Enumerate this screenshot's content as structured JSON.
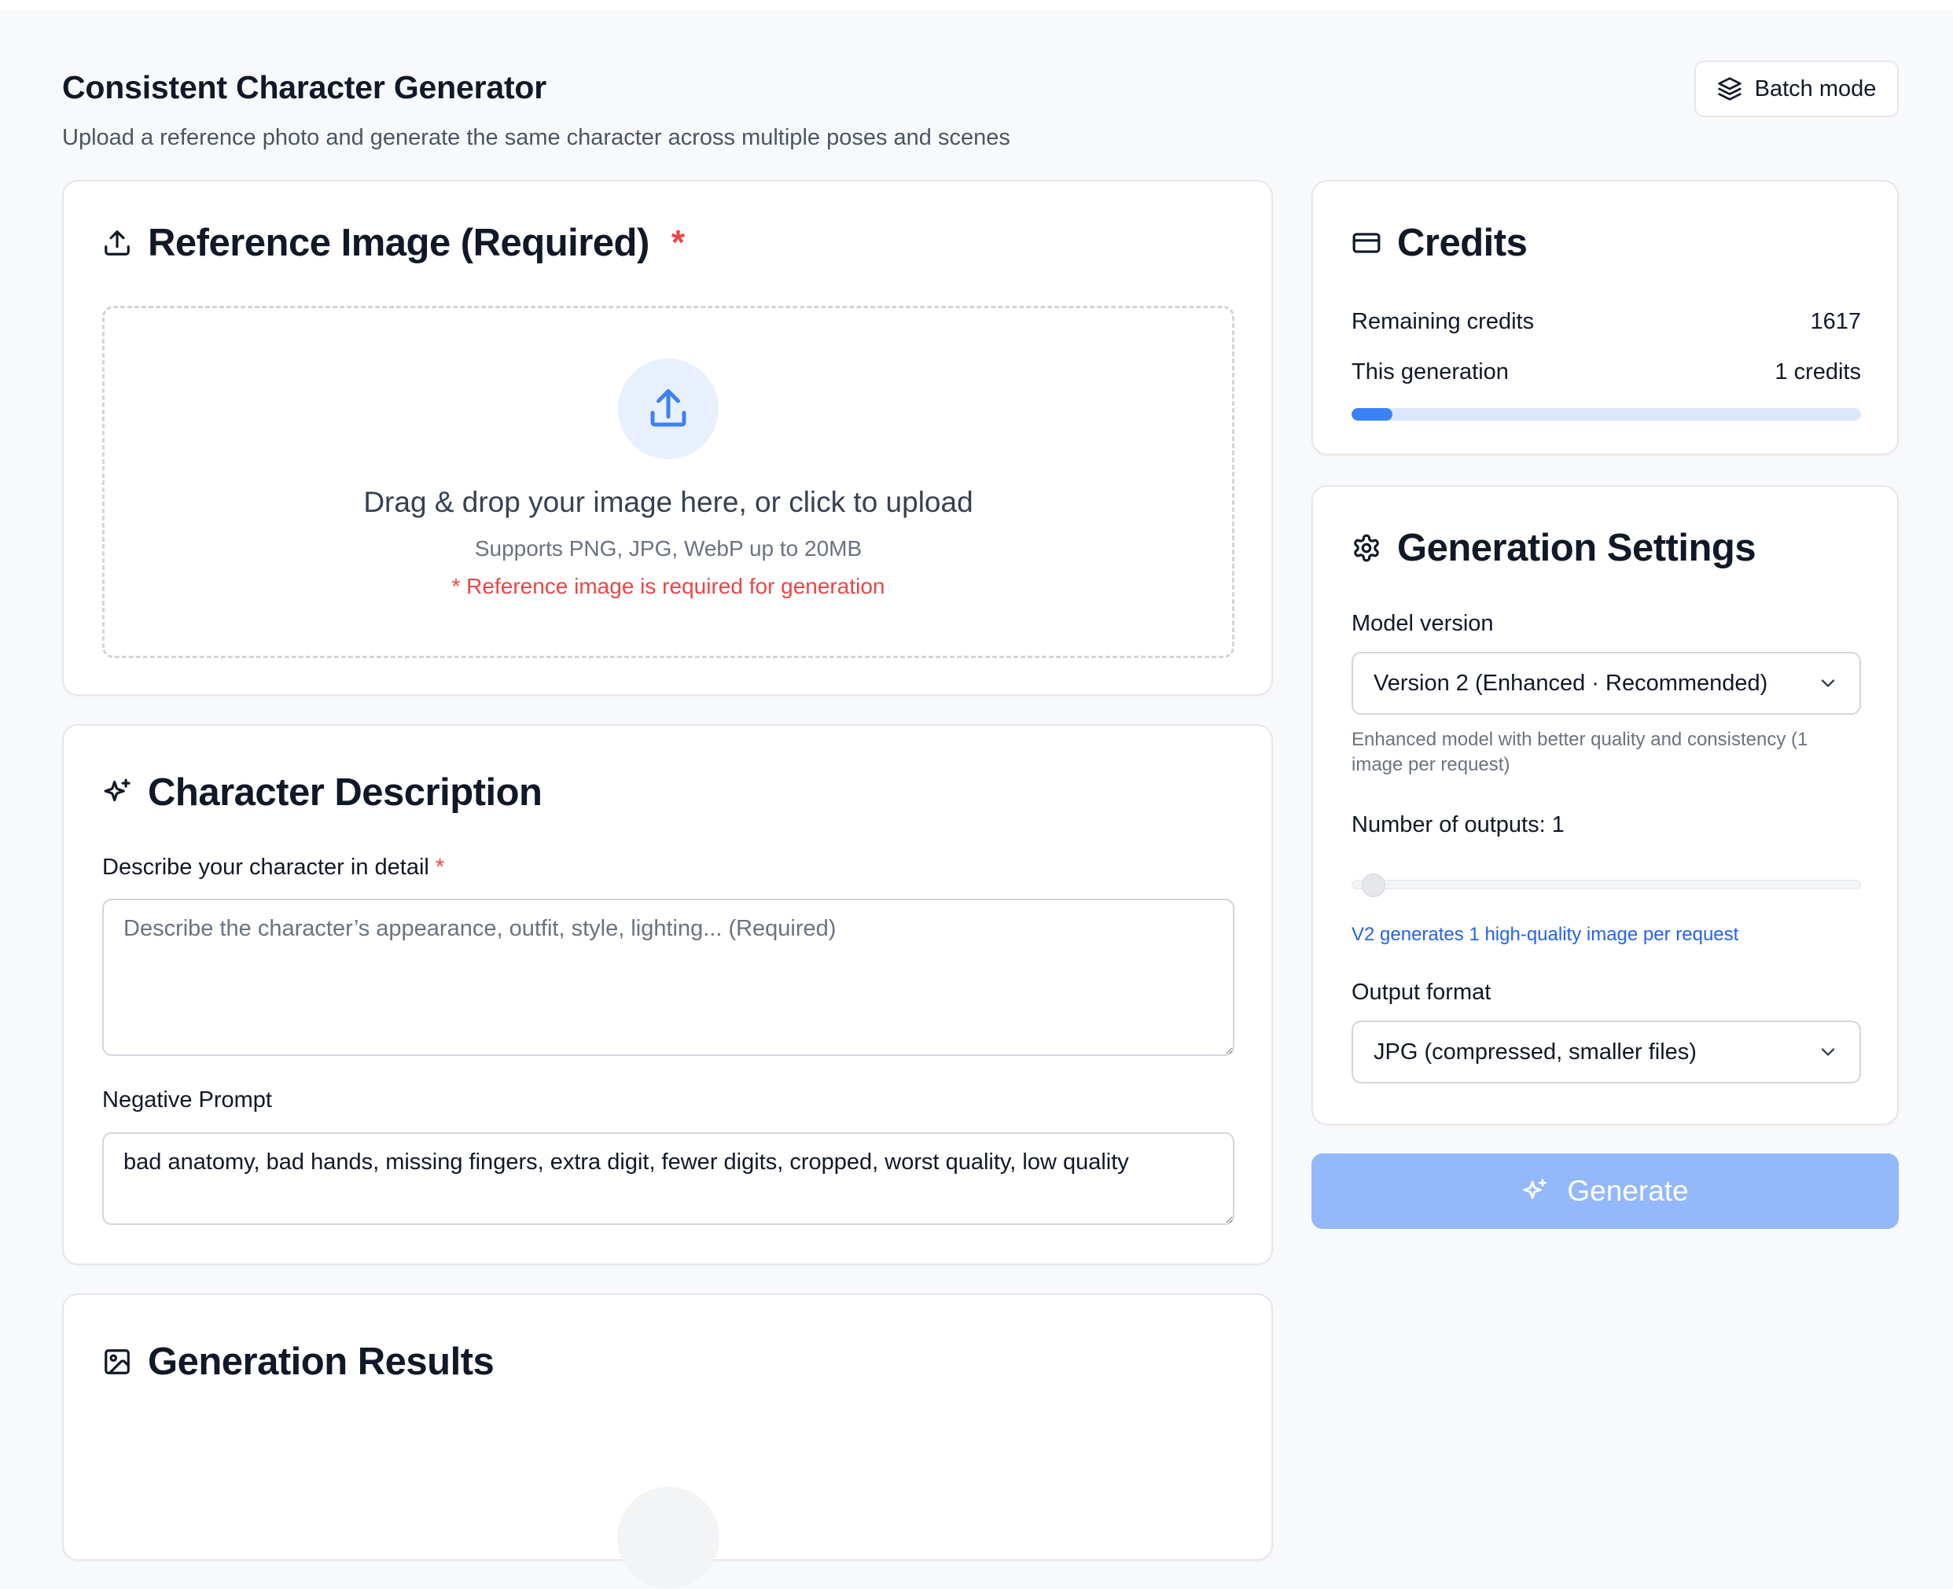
{
  "header": {
    "title": "Consistent Character Generator",
    "subtitle": "Upload a reference photo and generate the same character across multiple poses and scenes",
    "batch_label": "Batch mode"
  },
  "reference": {
    "title": "Reference Image (Required)",
    "required_mark": "*",
    "drop_main": "Drag & drop your image here, or click to upload",
    "drop_sub": "Supports PNG, JPG, WebP up to 20MB",
    "drop_warning": "* Reference image is required for generation"
  },
  "description": {
    "title": "Character Description",
    "desc_label": "Describe your character in detail",
    "desc_required": "*",
    "desc_placeholder": "Describe the character’s appearance, outfit, style, lighting... (Required)",
    "desc_value": "",
    "neg_label": "Negative Prompt",
    "neg_value": "bad anatomy, bad hands, missing fingers, extra digit, fewer digits, cropped, worst quality, low quality"
  },
  "results": {
    "title": "Generation Results"
  },
  "credits": {
    "title": "Credits",
    "remaining_label": "Remaining credits",
    "remaining_value": "1617",
    "generation_label": "This generation",
    "generation_value": "1 credits",
    "usage_fraction": 0.08
  },
  "settings": {
    "title": "Generation Settings",
    "model_label": "Model version",
    "model_value": "Version 2 (Enhanced · Recommended)",
    "model_help": "Enhanced model with better quality and consistency (1 image per request)",
    "outputs_label": "Number of outputs: 1",
    "outputs_value": 1,
    "outputs_note": "V2 generates 1 high-quality image per request",
    "format_label": "Output format",
    "format_value": "JPG (compressed, smaller files)"
  },
  "generate": {
    "label": "Generate"
  },
  "colors": {
    "accent": "#3b82f6",
    "required": "#ef4444",
    "generate_disabled": "#93b8fb",
    "link": "#2563eb"
  }
}
